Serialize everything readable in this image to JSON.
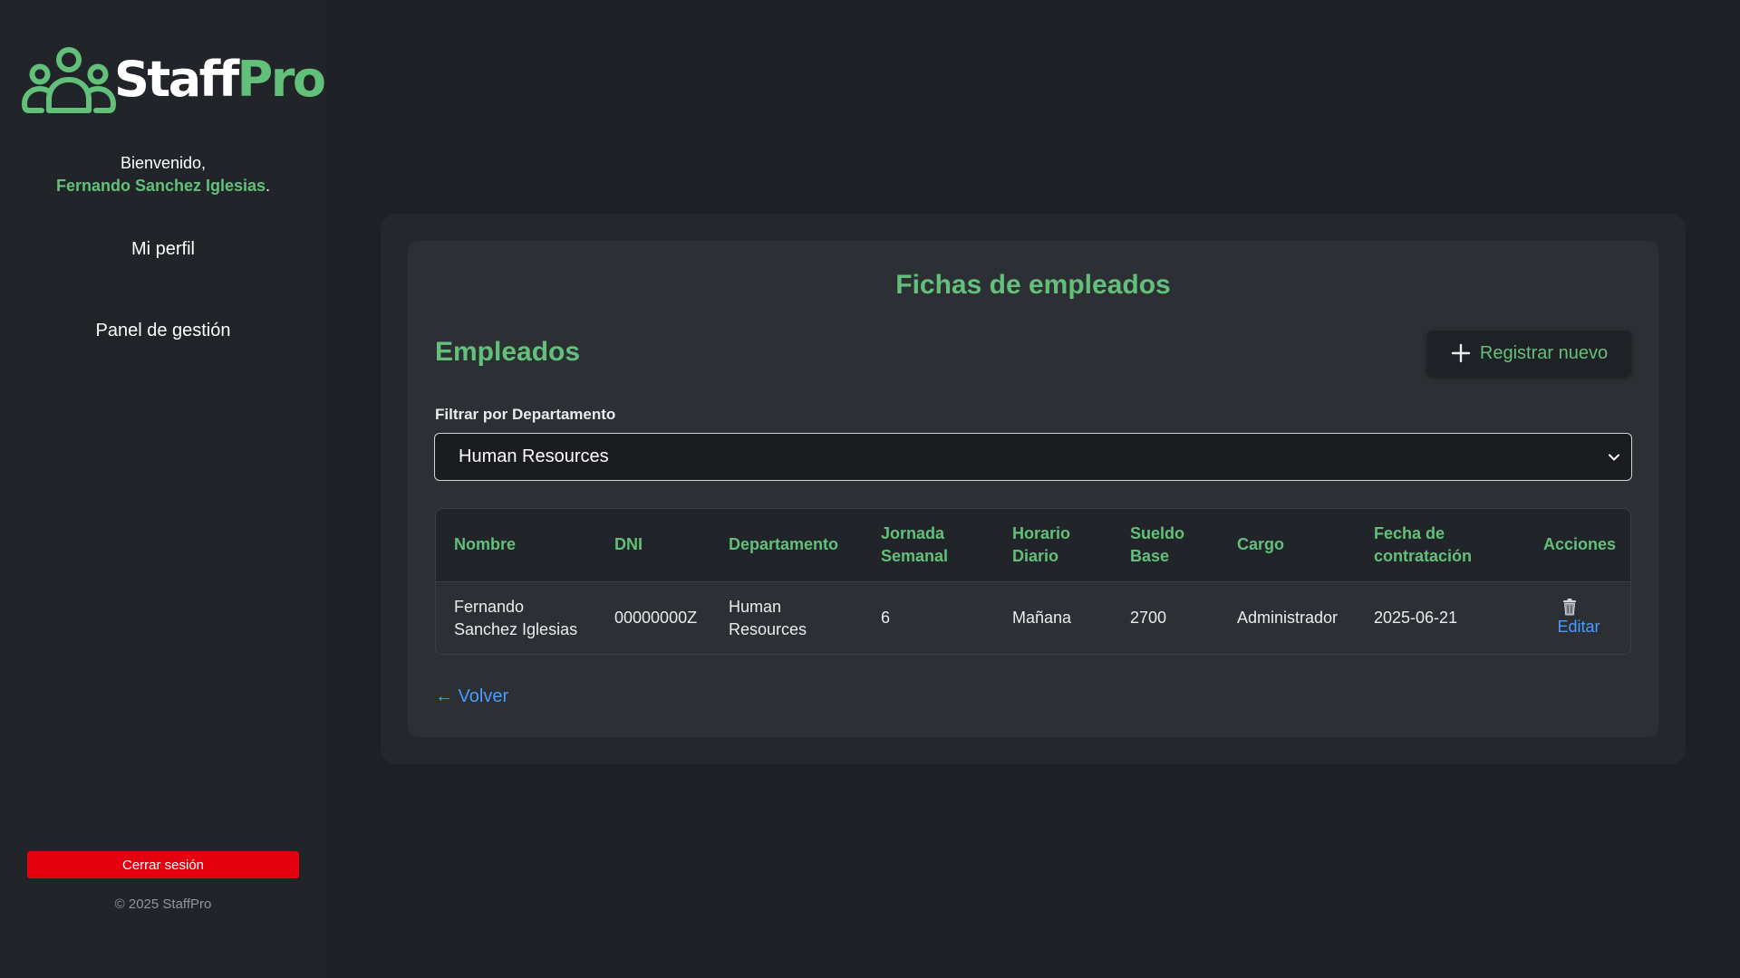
{
  "brand": {
    "name_part1": "Staff",
    "name_part2": "Pro",
    "accent_color": "#63c07a",
    "icon": "team-users-icon"
  },
  "sidebar": {
    "welcome_text": "Bienvenido,",
    "user_name": "Fernando Sanchez Iglesias",
    "user_name_suffix": ".",
    "nav_items": [
      {
        "label": "Mi perfil"
      },
      {
        "label": "Panel de gestión"
      }
    ],
    "logout_label": "Cerrar sesión",
    "logout_color": "#e4000f",
    "copyright": "© 2025 StaffPro"
  },
  "main": {
    "page_title": "Fichas de empleados",
    "section_title": "Empleados",
    "new_button_label": "Registrar nuevo",
    "new_button_icon": "plus-icon",
    "filter": {
      "label": "Filtrar por Departamento",
      "selected_value": "Human Resources"
    },
    "table": {
      "headers": [
        "Nombre",
        "DNI",
        "Departamento",
        "Jornada Semanal",
        "Horario Diario",
        "Sueldo Base",
        "Cargo",
        "Fecha de contratación",
        "Acciones"
      ],
      "rows": [
        {
          "nombre": "Fernando Sanchez Iglesias",
          "dni": "00000000Z",
          "departamento": "Human Resources",
          "jornada": "6",
          "horario": "Mañana",
          "sueldo": "2700",
          "cargo": "Administrador",
          "fecha": "2025-06-21",
          "delete_icon": "trash-icon",
          "edit_label": "Editar"
        }
      ]
    },
    "back_link": "← Volver",
    "link_color": "#4b9bff"
  }
}
